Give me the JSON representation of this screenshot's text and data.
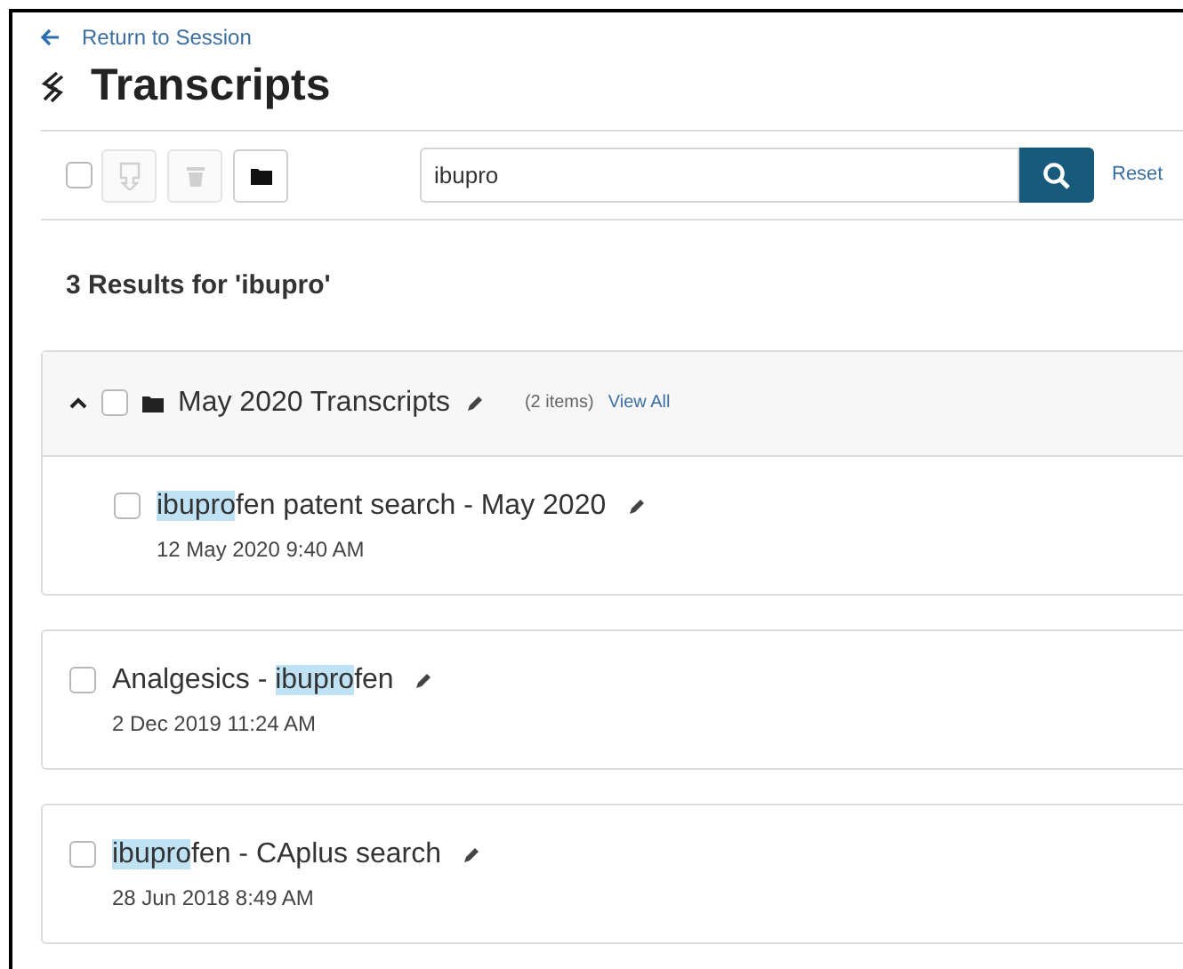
{
  "back_link": "Return to Session",
  "title": "Transcripts",
  "toolbar": {
    "select_all": {
      "checked": false
    },
    "buttons": [
      {
        "kind": "download",
        "disabled": true
      },
      {
        "kind": "delete",
        "disabled": true
      },
      {
        "kind": "folder",
        "disabled": false
      }
    ],
    "search": {
      "value": "ibupro"
    },
    "reset": "Reset"
  },
  "results_heading": "3 Results for 'ibupro'",
  "results": [
    {
      "kind": "folder",
      "expanded": true,
      "checked": false,
      "name": "May 2020 Transcripts",
      "count": "(2 items)",
      "view_all": "View All",
      "children": [
        {
          "kind": "transcript",
          "checked": false,
          "title_parts": [
            {
              "text": "ibupro",
              "highlighted": true
            },
            {
              "text": "fen patent search - May 2020",
              "highlighted": false
            }
          ],
          "date": "12 May 2020 9:40 AM"
        }
      ]
    },
    {
      "kind": "transcript",
      "checked": false,
      "title_parts": [
        {
          "text": "Analgesics - ",
          "highlighted": false
        },
        {
          "text": "ibupro",
          "highlighted": true
        },
        {
          "text": "fen",
          "highlighted": false
        }
      ],
      "date": "2 Dec 2019 11:24 AM"
    },
    {
      "kind": "transcript",
      "checked": false,
      "title_parts": [
        {
          "text": "ibupro",
          "highlighted": true
        },
        {
          "text": "fen - CAplus search",
          "highlighted": false
        }
      ],
      "date": "28 Jun 2018 8:49 AM"
    }
  ]
}
